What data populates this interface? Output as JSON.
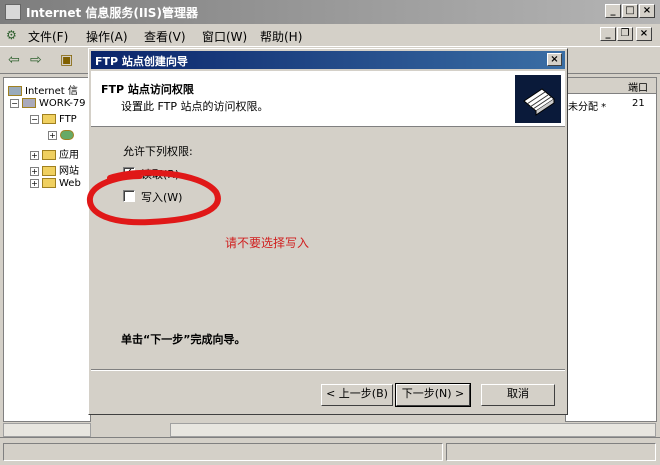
{
  "window": {
    "title": "Internet 信息服务(IIS)管理器",
    "controls": {
      "minimize": "_",
      "maximize": "□",
      "close": "×"
    }
  },
  "menubar": {
    "items": [
      "文件(F)",
      "操作(A)",
      "查看(V)",
      "窗口(W)",
      "帮助(H)"
    ],
    "mdi_controls": {
      "minimize": "_",
      "restore": "❐",
      "close": "×"
    }
  },
  "tree": {
    "root": "Internet 信",
    "server": "WORK-79",
    "ftp": "FTP",
    "app": "应用",
    "web": "网站",
    "webext": "Web"
  },
  "list": {
    "col_port": "端口",
    "row_fragment": "未分配 *",
    "row_port": "21"
  },
  "dialog": {
    "title": "FTP 站点创建向导",
    "close": "×",
    "header_title": "FTP 站点访问权限",
    "header_subtitle": "设置此 FTP 站点的访问权限。",
    "permissions_label": "允许下列权限:",
    "read_label": "读取(R)",
    "read_checked": true,
    "write_label": "写入(W)",
    "write_checked": false,
    "annotation": "请不要选择写入",
    "finish_text": "单击“下一步”完成向导。",
    "back_button": "< 上一步(B)",
    "next_button": "下一步(N) >",
    "cancel_button": "取消"
  },
  "colors": {
    "annotation": "#d02020",
    "dialog_titlebar": "#0a246a",
    "window_face": "#d4d0c8"
  }
}
